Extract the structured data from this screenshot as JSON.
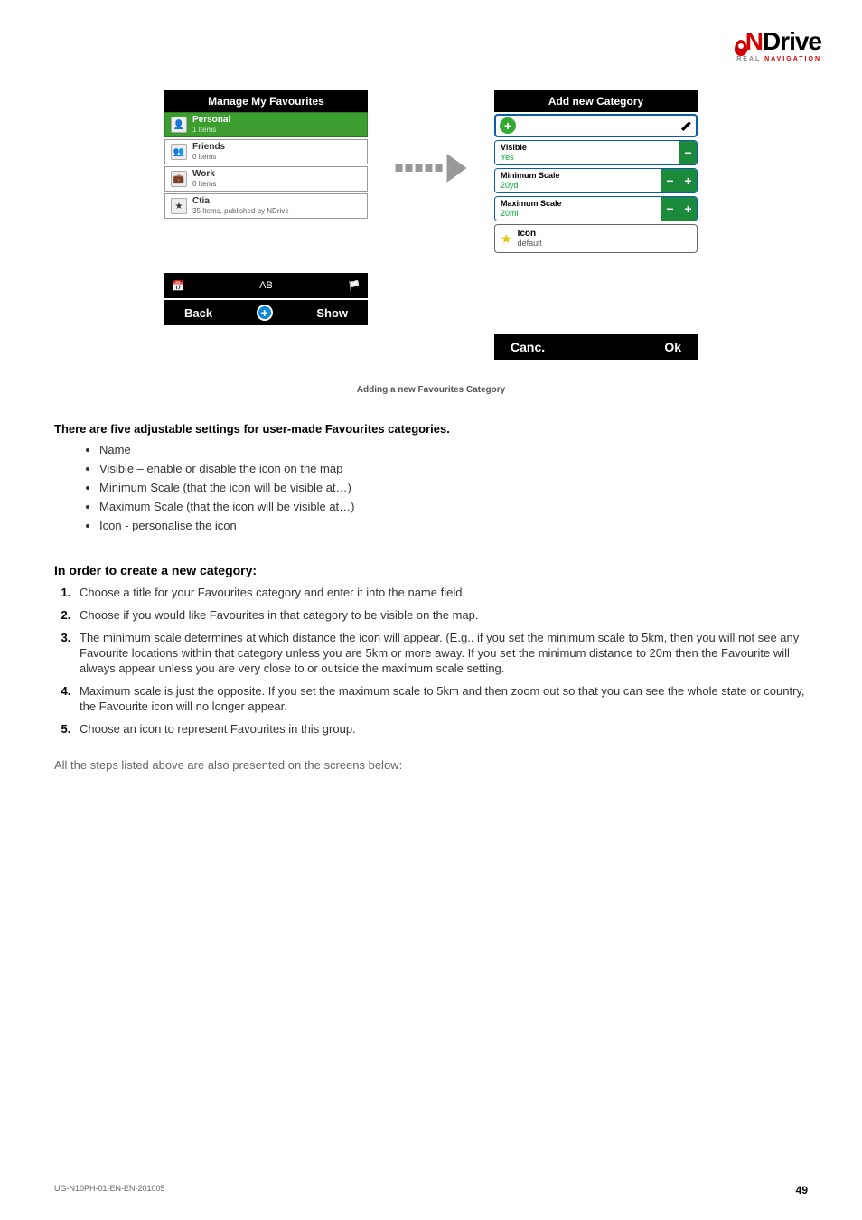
{
  "logo": {
    "brand_n": "N",
    "brand_rest": "Drive",
    "tagline_real": "REAL ",
    "tagline_nav": "NAVIGATION"
  },
  "left_panel": {
    "title": "Manage My Favourites",
    "items": [
      {
        "label": "Personal",
        "sub": "1 Items",
        "icon": "person-icon",
        "selected": true
      },
      {
        "label": "Friends",
        "sub": "0 Items",
        "icon": "people-icon",
        "selected": false
      },
      {
        "label": "Work",
        "sub": "0 Items",
        "icon": "briefcase-icon",
        "selected": false
      },
      {
        "label": "Ctia",
        "sub": "35 Items, published by NDrive",
        "icon": "star-icon",
        "selected": false
      }
    ],
    "toolbar_tabs": [
      "date-icon",
      "AB",
      "flag-icon"
    ],
    "buttons": {
      "back": "Back",
      "show": "Show"
    }
  },
  "right_panel": {
    "title": "Add new Category",
    "name_value": "",
    "rows": [
      {
        "key": "Visible",
        "value": "Yes",
        "minus": true,
        "plus": false
      },
      {
        "key": "Minimum Scale",
        "value": "20yd",
        "minus": true,
        "plus": true
      },
      {
        "key": "Maximum Scale",
        "value": "20mi",
        "minus": true,
        "plus": true
      }
    ],
    "icon_row": {
      "key": "Icon",
      "value": "default"
    },
    "buttons": {
      "cancel": "Canc.",
      "ok": "Ok"
    }
  },
  "caption": "Adding a new Favourites Category",
  "intro": "There are five adjustable settings for user-made Favourites categories.",
  "settings_list": [
    "Name",
    "Visible – enable or disable the icon on the map",
    "Minimum Scale (that the icon will be visible at…)",
    "Maximum Scale (that the icon will be visible at…)",
    "Icon - personalise the icon"
  ],
  "subheading": "In order to create a new category:",
  "steps": [
    "Choose a title for your Favourites category and enter it into the name field.",
    "Choose if you would like Favourites in that category to be visible on the map.",
    "The minimum scale determines at which distance the icon will appear. (E.g.. if you set the minimum scale to 5km, then you will not see any Favourite locations within that category unless you are 5km or more away. If you set the minimum distance to 20m then the Favourite will always appear unless you are very close to or outside the maximum scale setting.",
    "Maximum scale is just the opposite. If you set the maximum scale to 5km and then zoom out so that you can see the whole state or country, the Favourite icon will no longer appear.",
    "Choose an icon to represent Favourites in this group."
  ],
  "after_steps": "All the steps listed above are also presented on the screens below:",
  "footer": {
    "doc_id": "UG-N10PH-01-EN-EN-201005",
    "page": "49"
  }
}
